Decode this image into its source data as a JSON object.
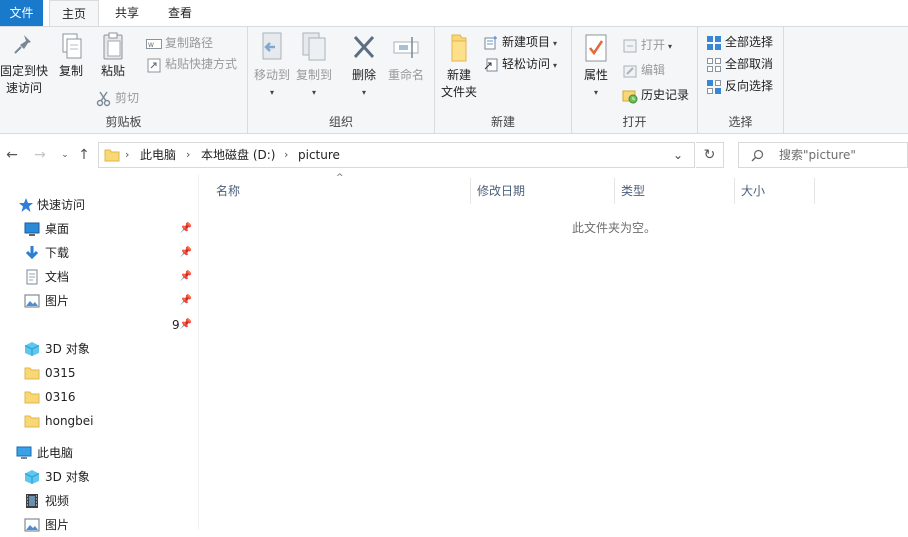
{
  "tabs": {
    "file": "文件",
    "home": "主页",
    "share": "共享",
    "view": "查看"
  },
  "ribbon": {
    "clipboard": {
      "label": "剪贴板",
      "pin_quick": "固定到快\n速访问",
      "pin_quick_l1": "固定到快",
      "pin_quick_l2": "速访问",
      "copy": "复制",
      "paste": "粘贴",
      "copy_path": "复制路径",
      "paste_shortcut": "粘贴快捷方式",
      "cut": "剪切"
    },
    "organize": {
      "label": "组织",
      "move_to": "移动到",
      "copy_to": "复制到",
      "delete": "删除",
      "rename": "重命名"
    },
    "new": {
      "label": "新建",
      "new_folder_l1": "新建",
      "new_folder_l2": "文件夹",
      "new_item": "新建项目",
      "easy_access": "轻松访问"
    },
    "open": {
      "label": "打开",
      "properties": "属性",
      "open": "打开",
      "edit": "编辑",
      "history": "历史记录"
    },
    "select": {
      "label": "选择",
      "select_all": "全部选择",
      "select_none": "全部取消",
      "invert": "反向选择"
    }
  },
  "address": {
    "crumbs": [
      "此电脑",
      "本地磁盘 (D:)",
      "picture"
    ],
    "search_placeholder": "搜索\"picture\""
  },
  "nav": {
    "quick_access": "快速访问",
    "items": [
      {
        "label": "桌面",
        "pinned": true
      },
      {
        "label": "下载",
        "pinned": true
      },
      {
        "label": "文档",
        "pinned": true
      },
      {
        "label": "图片",
        "pinned": true
      },
      {
        "label": "",
        "count": "9",
        "pinned": true
      },
      {
        "label": "3D 对象"
      },
      {
        "label": "0315"
      },
      {
        "label": "0316"
      },
      {
        "label": "hongbei"
      }
    ],
    "this_pc": "此电脑",
    "pc_items": [
      "3D 对象",
      "视频",
      "图片"
    ]
  },
  "columns": {
    "name": "名称",
    "modified": "修改日期",
    "type": "类型",
    "size": "大小"
  },
  "empty_message": "此文件夹为空。",
  "colors": {
    "accent": "#1979ca",
    "folder": "#f8d775",
    "header_text": "#4c607a"
  }
}
